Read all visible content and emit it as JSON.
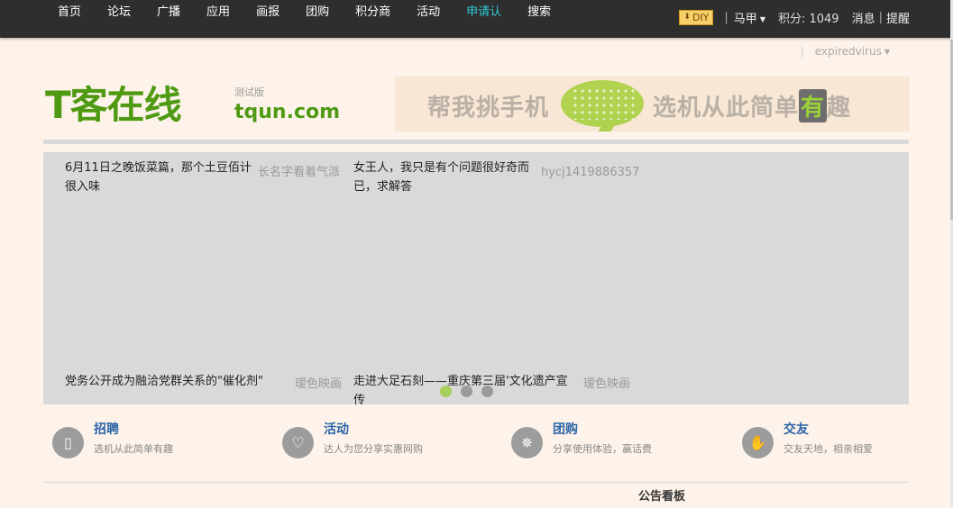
{
  "nav": {
    "items": [
      "首页",
      "论坛",
      "广播",
      "应用",
      "画报",
      "团购",
      "积分商",
      "活动",
      "申请认",
      "搜索"
    ],
    "active_index": 8
  },
  "topright": {
    "diy_label": "DIY",
    "user_menu": "马甲",
    "points_text": "积分: 1049",
    "messages": "消息",
    "reminders": "提醒"
  },
  "userrow": {
    "username": "expiredvirus"
  },
  "logo": {
    "main": "T客在线",
    "beta": "测试版",
    "domain": "tqun.com"
  },
  "banner": {
    "text1": "帮我挑手机",
    "text2_pre": "选机从此简单",
    "text2_hl": "有",
    "text2_post": "趣"
  },
  "strip": {
    "text": ""
  },
  "slider": {
    "cards": [
      {
        "title": "6月11日之晚饭菜篇，那个土豆佰计很入味",
        "author": "长名字看着气派"
      },
      {
        "title": "女王人，我只是有个问题很好奇而已，求解答",
        "author": "hycj1419886357"
      },
      {
        "title": "党务公开成为融洽党群关系的\"催化剂\"",
        "author": "瑷色映画"
      },
      {
        "title": "走进大足石刻——重庆第三届'文化遗产宣传",
        "author": "瑷色映画"
      }
    ],
    "page_count": 3,
    "active_page": 0
  },
  "features": [
    {
      "title": "招聘",
      "desc": "选机从此简单有趣",
      "icon": "phone-icon"
    },
    {
      "title": "活动",
      "desc": "达人为您分享实惠网购",
      "icon": "heart-icon"
    },
    {
      "title": "团购",
      "desc": "分享使用体验，赢话费",
      "icon": "tag-icon"
    },
    {
      "title": "交友",
      "desc": "交友天地，相亲相爱",
      "icon": "hand-icon"
    }
  ],
  "notice": {
    "title": "公告看板"
  },
  "colors": {
    "topbar": "#2e2e2e",
    "active_nav": "#2fc8d8",
    "brand_green": "#4f9a12",
    "link_blue": "#2b64a8",
    "page_bg": "#fdf3ea",
    "slider_bg": "#d9d9d9"
  }
}
